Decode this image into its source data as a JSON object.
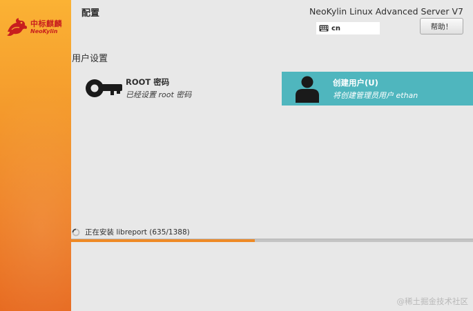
{
  "sidebar": {
    "logo_cn": "中标麒麟",
    "logo_en": "NeoKylin"
  },
  "header": {
    "spoke_title": "配置",
    "product_title": "NeoKylin Linux Advanced Server V7",
    "keyboard_layout": "cn",
    "help_label": "帮助！"
  },
  "section": {
    "title": "用户设置"
  },
  "spokes": [
    {
      "name": "ROOT 密码",
      "status": "已经设置 root 密码",
      "icon": "key-icon",
      "selected": false
    },
    {
      "name": "创建用户(U)",
      "status": "将创建管理员用户 ethan",
      "icon": "user-icon",
      "selected": true
    }
  ],
  "progress": {
    "status_text": "正在安装 libreport (635/1388)",
    "fraction": 0.4575
  },
  "watermark": "@稀土掘金技术社区",
  "colors": {
    "accent_selected": "#4fb6be",
    "progress_fill": "#ee8a26",
    "sidebar_top": "#fbb234",
    "sidebar_bottom": "#e7691e"
  }
}
